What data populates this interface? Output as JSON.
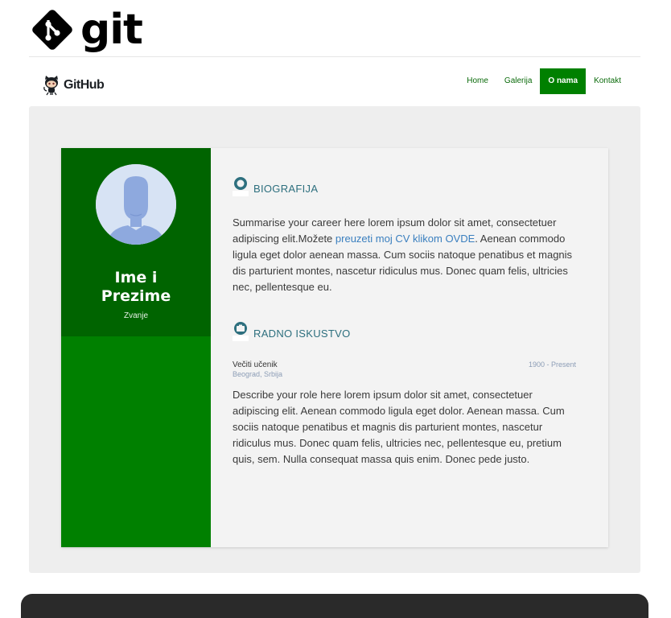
{
  "brand": {
    "git_wordmark": "git",
    "github_wordmark": "GitHub"
  },
  "nav": {
    "items": [
      {
        "label": "Home"
      },
      {
        "label": "Galerija"
      },
      {
        "label": "O nama",
        "active": true
      },
      {
        "label": "Kontakt"
      }
    ]
  },
  "profile": {
    "name_line1": "Ime i",
    "name_line2": "Prezime",
    "role": "Zvanje"
  },
  "biography": {
    "heading": "BIOGRAFIJA",
    "text_before_link": "Summarise your career here lorem ipsum dolor sit amet, consectetuer adipiscing elit.Možete ",
    "link_text": "preuzeti moj CV klikom OVDE",
    "text_after_link": ". Aenean commodo ligula eget dolor aenean massa. Cum sociis natoque penatibus et magnis dis parturient montes, nascetur ridiculus mus. Donec quam felis, ultricies nec, pellentesque eu."
  },
  "experience": {
    "heading": "RADNO ISKUSTVO",
    "job_title": "Večiti učenik",
    "location": "Beograd, Srbija",
    "dates": "1900 - Present",
    "description": "Describe your role here lorem ipsum dolor sit amet, consectetuer adipiscing elit. Aenean commodo ligula eget dolor. Aenean massa. Cum sociis natoque penatibus et magnis dis parturient montes, nascetur ridiculus mus. Donec quam felis, ultricies nec, pellentesque eu, pretium quis, sem. Nulla consequat massa quis enim. Donec pede justo."
  },
  "colors": {
    "sidebar_green": "#008000",
    "sidebar_dark_green": "#006400",
    "section_heading": "#2d6f7e",
    "link_blue": "#3a7fbf"
  }
}
